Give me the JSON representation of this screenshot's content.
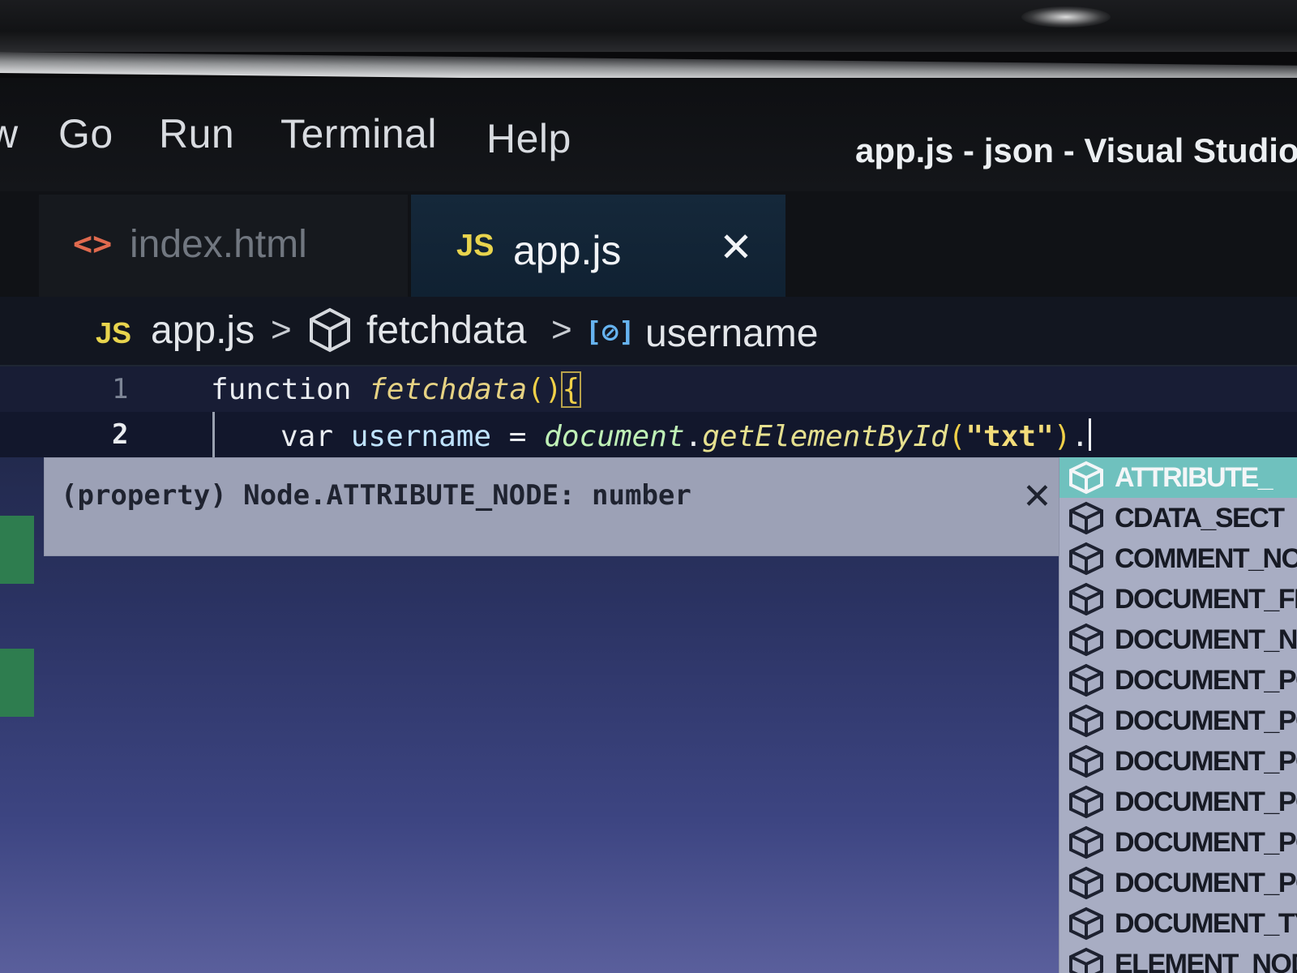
{
  "window": {
    "title": "app.js - json - Visual Studio"
  },
  "menu": {
    "items": [
      "w",
      "Go",
      "Run",
      "Terminal",
      "Help"
    ]
  },
  "tabs": [
    {
      "icon": "<>",
      "label": "index.html",
      "active": false
    },
    {
      "icon": "JS",
      "label": "app.js",
      "active": true,
      "close": "✕"
    }
  ],
  "breadcrumb": {
    "file_icon": "JS",
    "file": "app.js",
    "function": "fetchdata",
    "variable_icon": "[⊘]",
    "variable": "username",
    "separator": ">"
  },
  "code": {
    "lines": [
      {
        "number": "1",
        "tokens": {
          "keyword": "function",
          "name": "fetchdata",
          "parens": "()",
          "brace": "{"
        }
      },
      {
        "number": "2",
        "tokens": {
          "keyword": "var",
          "name": "username",
          "equals": "=",
          "object": "document",
          "dot1": ".",
          "method": "getElementById",
          "open": "(",
          "string": "\"txt\"",
          "close": ")",
          "dot2": "."
        }
      }
    ]
  },
  "hover": {
    "text": "(property) Node.ATTRIBUTE_NODE: number",
    "close": "✕"
  },
  "suggestions": [
    {
      "label": "ATTRIBUTE_",
      "selected": true
    },
    {
      "label": "CDATA_SECT",
      "selected": false
    },
    {
      "label": "COMMENT_NO",
      "selected": false
    },
    {
      "label": "DOCUMENT_FI",
      "selected": false
    },
    {
      "label": "DOCUMENT_NO",
      "selected": false
    },
    {
      "label": "DOCUMENT_PO",
      "selected": false
    },
    {
      "label": "DOCUMENT_PO",
      "selected": false
    },
    {
      "label": "DOCUMENT_PO",
      "selected": false
    },
    {
      "label": "DOCUMENT_PO",
      "selected": false
    },
    {
      "label": "DOCUMENT_PO",
      "selected": false
    },
    {
      "label": "DOCUMENT_PO",
      "selected": false
    },
    {
      "label": "DOCUMENT_TYP",
      "selected": false
    },
    {
      "label": "ELEMENT_NODE",
      "selected": false
    }
  ],
  "colors": {
    "js_icon": "#e8d44d",
    "html_icon": "#e06a4e",
    "selected_suggestion": "#6fc1be",
    "hover_bg": "#9ca1b6"
  },
  "icons": {
    "html_tab": "html-file-icon",
    "js_tab": "js-file-icon",
    "function": "cube-icon",
    "variable": "variable-icon",
    "suggestion": "constant-cube-icon"
  }
}
